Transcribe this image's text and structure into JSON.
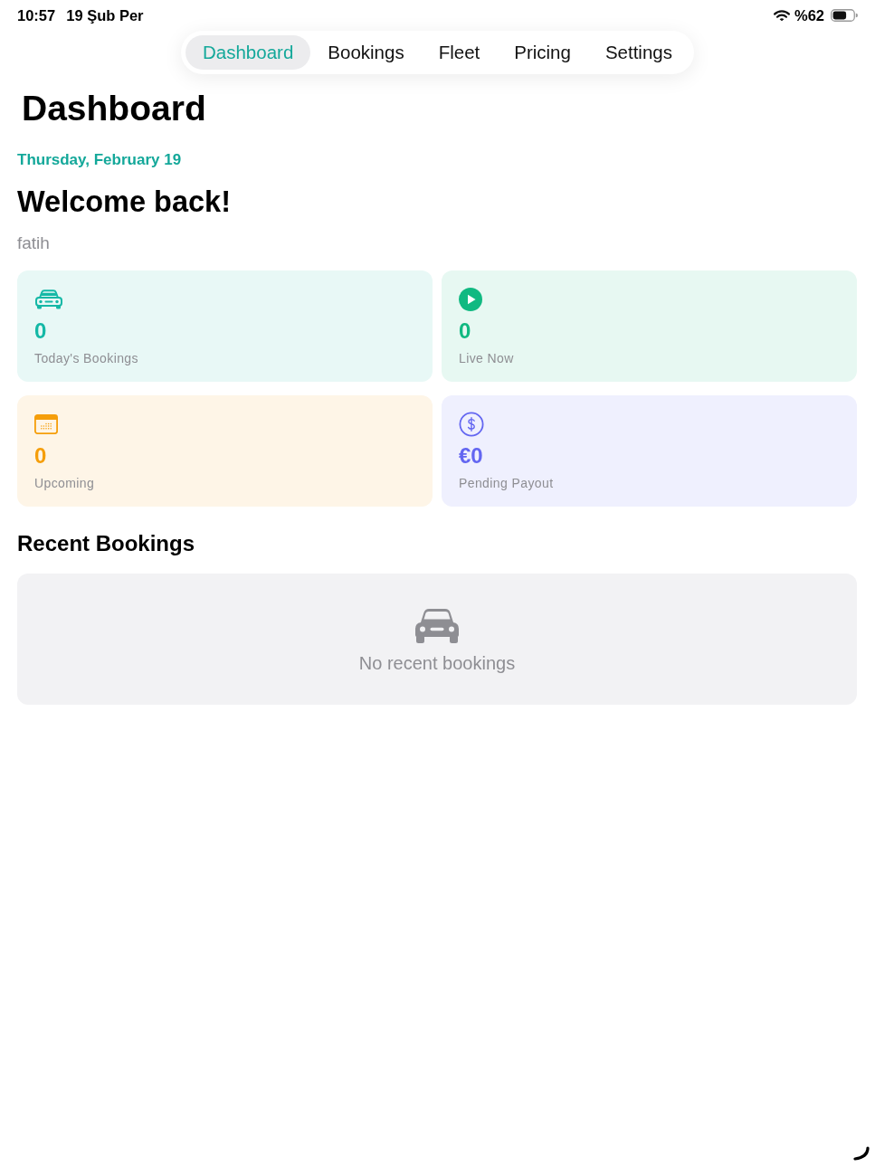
{
  "status_bar": {
    "time": "10:57",
    "date": "19 Şub Per",
    "battery": "%62"
  },
  "tabs": [
    {
      "label": "Dashboard",
      "selected": true
    },
    {
      "label": "Bookings",
      "selected": false
    },
    {
      "label": "Fleet",
      "selected": false
    },
    {
      "label": "Pricing",
      "selected": false
    },
    {
      "label": "Settings",
      "selected": false
    }
  ],
  "page_title": "Dashboard",
  "date": "Thursday, February 19",
  "greeting": "Welcome back!",
  "user_name": "fatih",
  "stats": [
    {
      "kind": "car",
      "value": "0",
      "label": "Today's Bookings",
      "color": "#14b8a6"
    },
    {
      "kind": "live",
      "value": "0",
      "label": "Live Now",
      "color": "#10b981"
    },
    {
      "kind": "calendar",
      "value": "0",
      "label": "Upcoming",
      "color": "#f59e0b"
    },
    {
      "kind": "payout",
      "value": "€0",
      "label": "Pending Payout",
      "color": "#6366f1"
    }
  ],
  "recent_bookings": {
    "title": "Recent Bookings",
    "empty_message": "No recent bookings"
  }
}
